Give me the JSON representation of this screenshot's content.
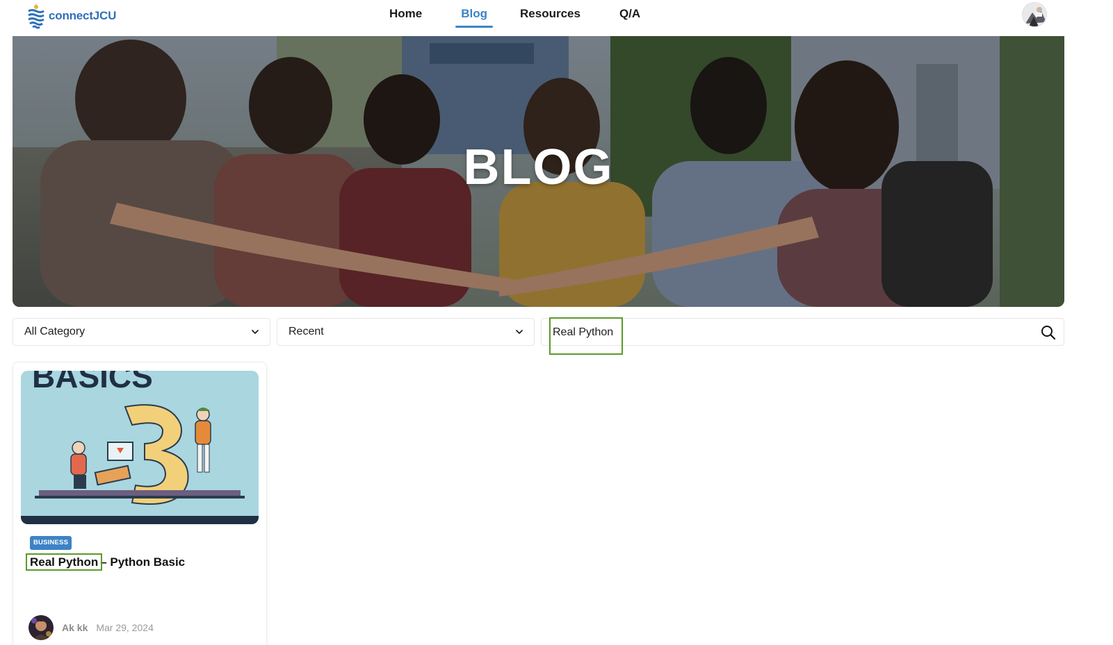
{
  "brand": {
    "name": "connectJCU",
    "color": "#2f6fba"
  },
  "nav": {
    "items": [
      {
        "label": "Home",
        "active": false
      },
      {
        "label": "Blog",
        "active": true
      },
      {
        "label": "Resources",
        "active": false
      },
      {
        "label": "Q/A",
        "active": false
      }
    ],
    "accent": "#3c83c6"
  },
  "hero": {
    "title": "BLOG"
  },
  "filters": {
    "category": {
      "selected": "All Category",
      "icon": "chevron-down-icon"
    },
    "sort": {
      "selected": "Recent",
      "icon": "chevron-down-icon"
    },
    "search": {
      "value": "Real Python",
      "icon": "search-icon"
    }
  },
  "posts": [
    {
      "image_text": "BASICS",
      "category": "BUSINESS",
      "title_highlight": "Real Python",
      "title_rest": "– Python Basic",
      "author": "Ak kk",
      "date": "Mar 29, 2024"
    }
  ],
  "highlight_color": "#5a9a2b"
}
